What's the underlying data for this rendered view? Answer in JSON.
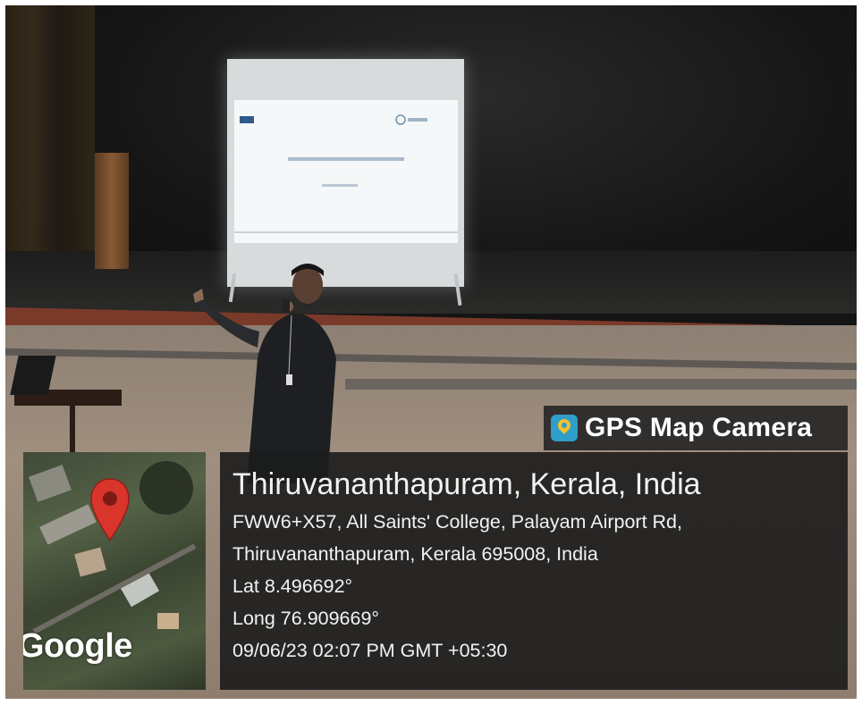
{
  "overlay": {
    "brand": "GPS Map Camera",
    "location_title": "Thiruvananthapuram, Kerala, India",
    "address_line1": "FWW6+X57, All Saints' College, Palayam Airport Rd,",
    "address_line2": "Thiruvananthapuram, Kerala 695008, India",
    "latitude": "Lat 8.496692°",
    "longitude": "Long 76.909669°",
    "timestamp": "09/06/23 02:07 PM GMT +05:30"
  },
  "map": {
    "provider_logo": "Google",
    "pin_icon": "map-pin-icon",
    "pin_color": "#d9352b"
  },
  "colors": {
    "overlay_bg": "#1c1c1c",
    "text": "#f2f2f2",
    "app_icon": "#2f9ec9"
  }
}
